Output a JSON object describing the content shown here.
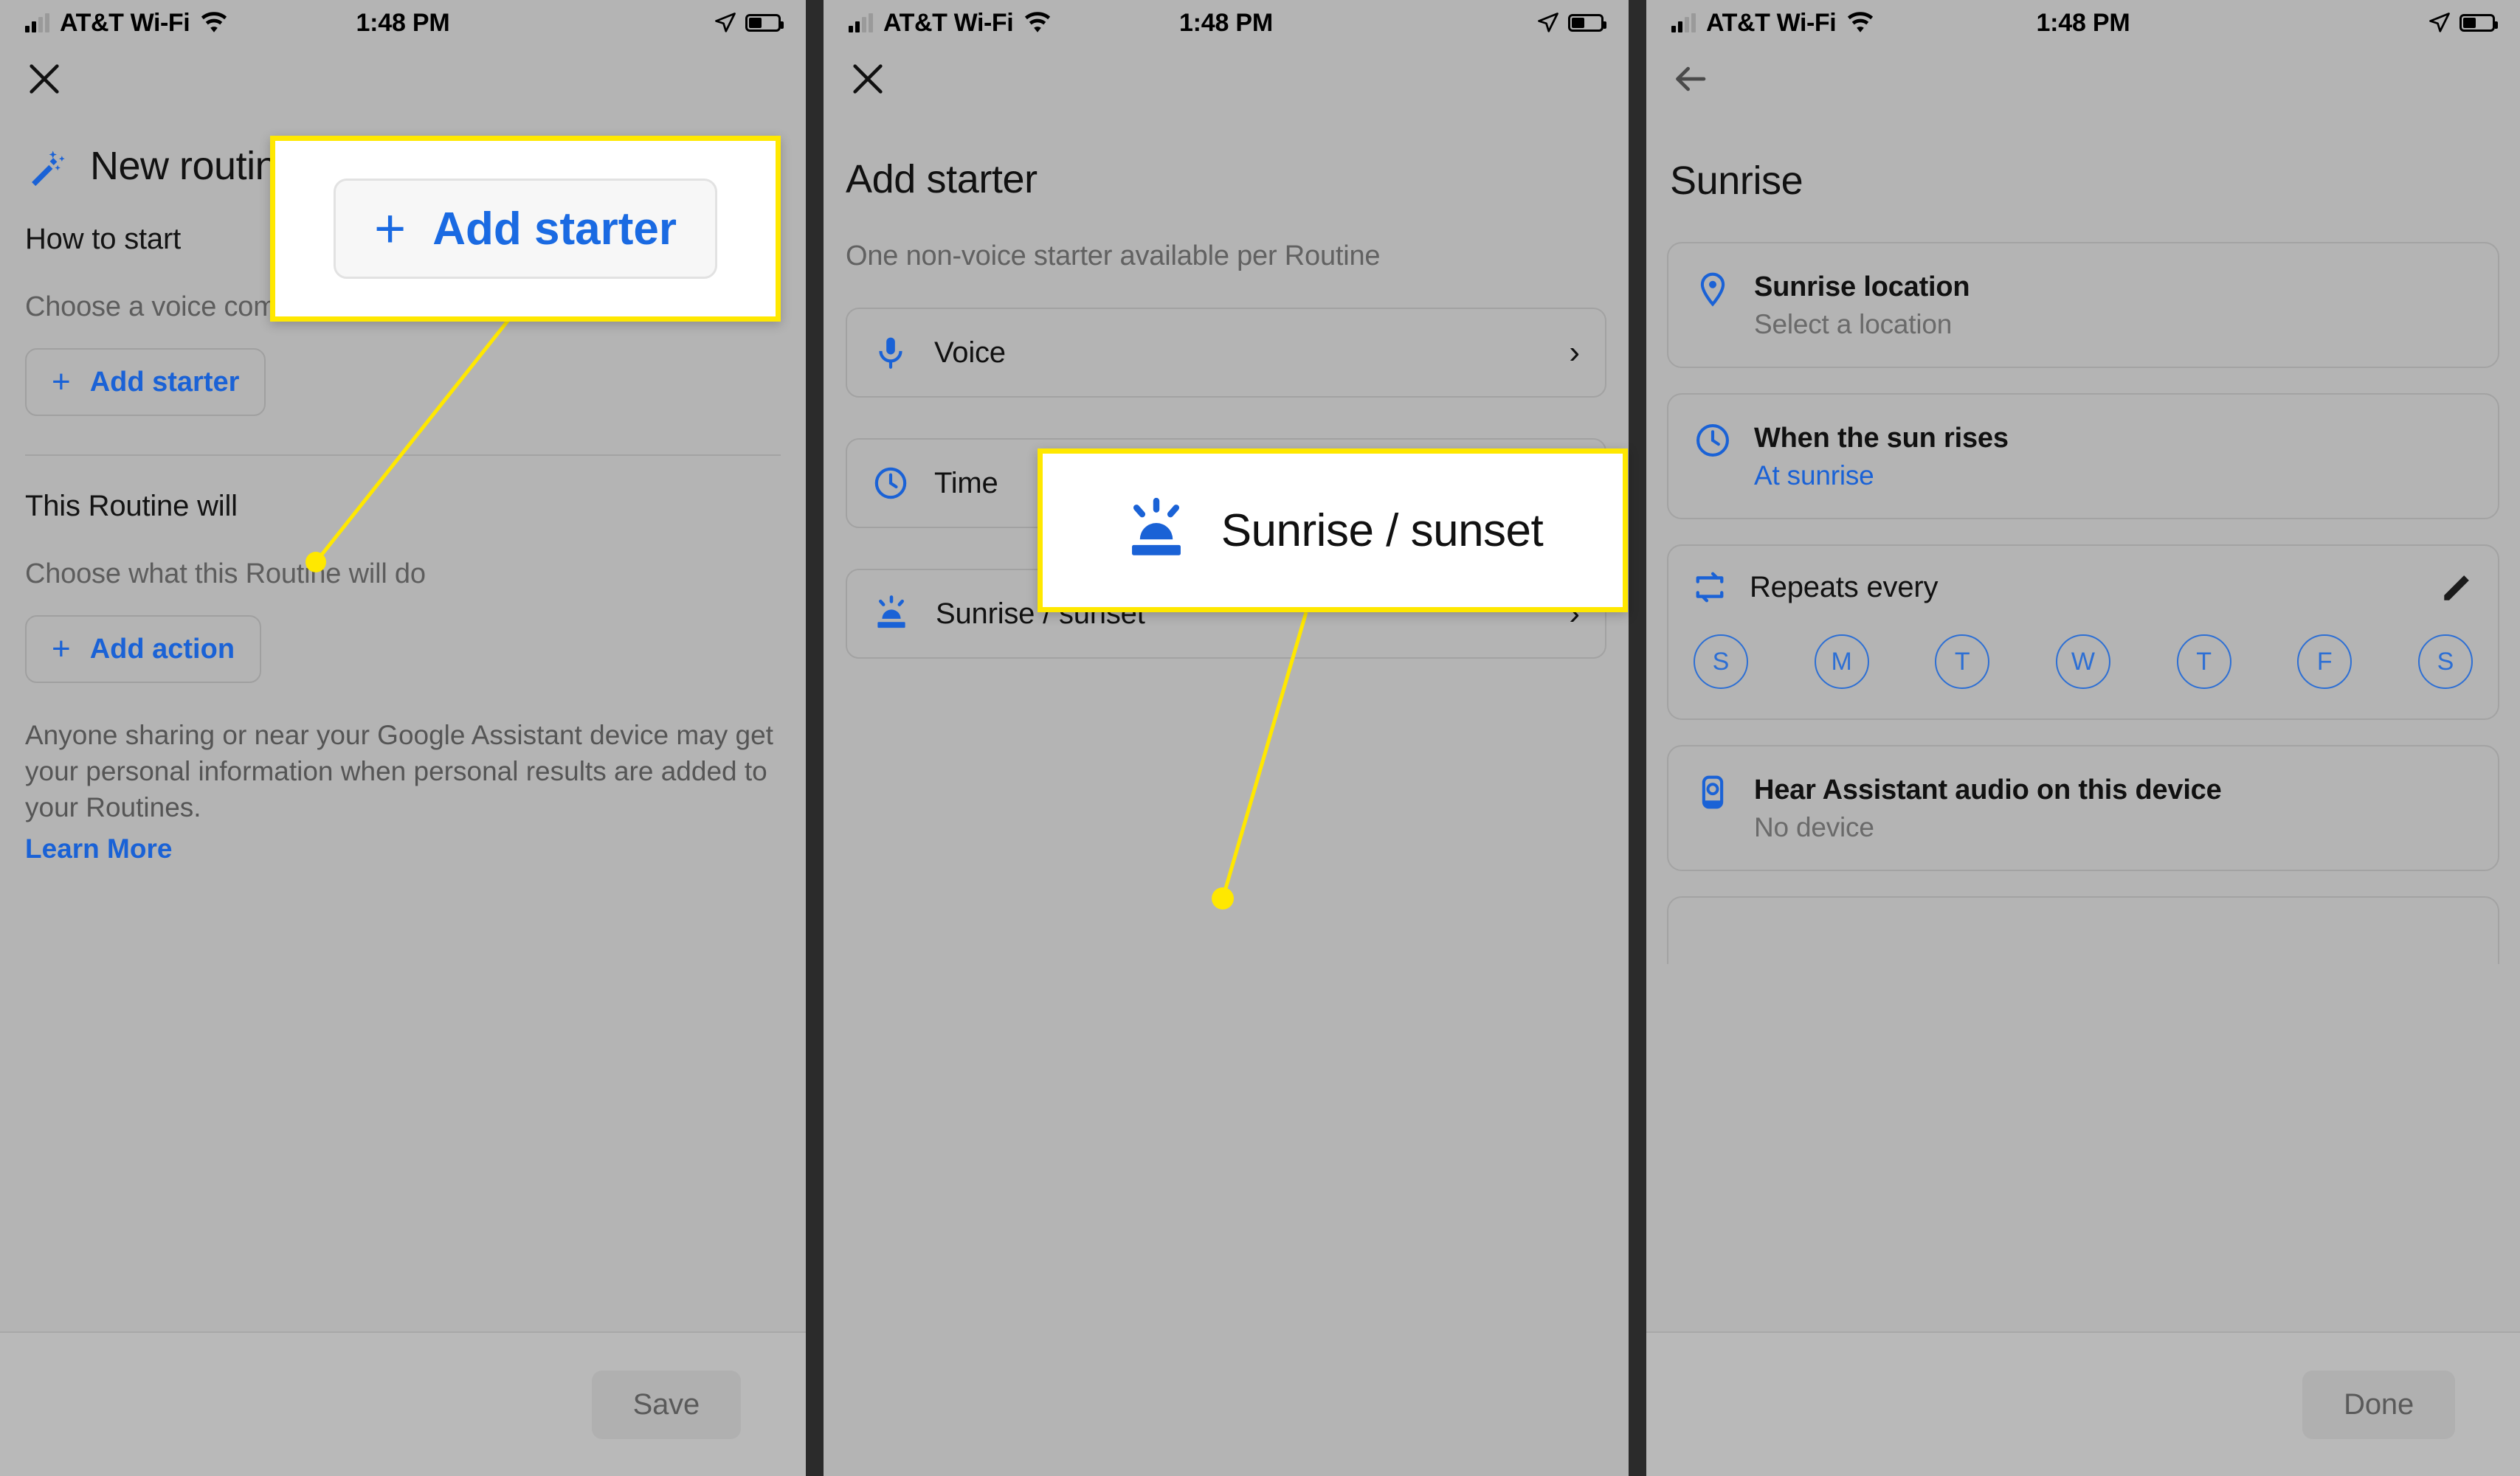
{
  "status_bar": {
    "carrier": "AT&T Wi-Fi",
    "time": "1:48 PM",
    "icons": [
      "signal-bars-icon",
      "wifi-icon",
      "location-arrow-icon",
      "battery-icon"
    ]
  },
  "colors": {
    "accent_blue": "#1a62d6",
    "highlight_yellow": "#ffe800",
    "screen_bg": "#b4b4b4",
    "card_border": "#a2a2a2",
    "muted_text": "#5d5d5d"
  },
  "panel1": {
    "close_label": "✕",
    "routine_title": "New routine",
    "wand_icon": "magic-wand-icon",
    "how_to_start_heading": "How to start",
    "how_to_start_sub": "Choose a voice command or a time",
    "add_starter_label": "Add starter",
    "routine_will_heading": "This Routine will",
    "routine_will_sub": "Choose what this Routine will do",
    "add_action_label": "Add action",
    "disclaimer": "Anyone sharing or near your Google Assistant device may get your personal information when personal results are added to your Routines.",
    "learn_more_label": "Learn More",
    "save_label": "Save"
  },
  "panel2": {
    "close_label": "✕",
    "title": "Add starter",
    "subtitle": "One non-voice starter available per Routine",
    "items": [
      {
        "label": "Voice",
        "icon": "microphone-icon"
      },
      {
        "label": "Time",
        "icon": "clock-icon"
      },
      {
        "label": "Sunrise / sunset",
        "icon": "sunrise-icon"
      }
    ],
    "chevron": "›"
  },
  "panel3": {
    "back_label": "←",
    "title": "Sunrise",
    "cards": [
      {
        "title": "Sunrise location",
        "sub": "Select a location",
        "sub_style": "muted",
        "icon": "location-pin-icon"
      },
      {
        "title": "When the sun rises",
        "sub": "At sunrise",
        "sub_style": "blue",
        "icon": "clock-icon"
      },
      {
        "title": "Hear Assistant audio on this device",
        "sub": "No device",
        "sub_style": "muted",
        "icon": "speaker-device-icon"
      }
    ],
    "repeats": {
      "label": "Repeats every",
      "icon": "repeat-icon",
      "edit_icon": "pencil-icon",
      "days": [
        "S",
        "M",
        "T",
        "W",
        "T",
        "F",
        "S"
      ]
    },
    "done_label": "Done"
  },
  "callouts": {
    "one": {
      "label": "Add starter",
      "plus": "+",
      "icon": "plus-icon"
    },
    "two": {
      "label": "Sunrise / sunset",
      "icon": "sunrise-icon"
    }
  }
}
